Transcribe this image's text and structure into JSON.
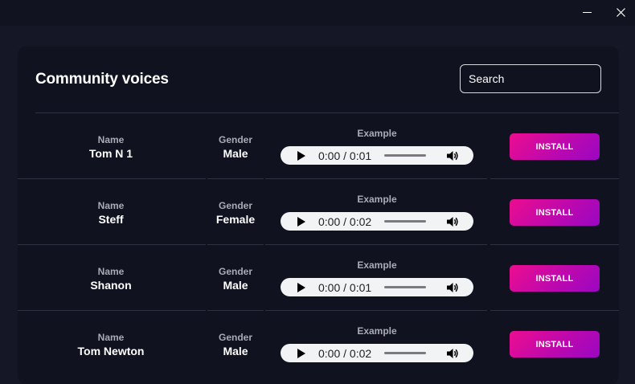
{
  "window": {
    "minimize_icon": "minimize-icon",
    "close_icon": "close-icon"
  },
  "page": {
    "title": "Community voices",
    "search_placeholder": "Search"
  },
  "columns": {
    "name": "Name",
    "gender": "Gender",
    "example": "Example"
  },
  "install_label": "INSTALL",
  "voices": [
    {
      "name": "Tom N 1",
      "gender": "Male",
      "time": "0:00 / 0:01"
    },
    {
      "name": "Steff",
      "gender": "Female",
      "time": "0:00 / 0:02"
    },
    {
      "name": "Shanon",
      "gender": "Male",
      "time": "0:00 / 0:01"
    },
    {
      "name": "Tom Newton",
      "gender": "Male",
      "time": "0:00 / 0:02"
    }
  ],
  "colors": {
    "background": "#151726",
    "panel": "#101220",
    "accent_start": "#ec0d8f",
    "accent_end": "#9a07c2",
    "audio_bg": "#f1f3f4"
  }
}
